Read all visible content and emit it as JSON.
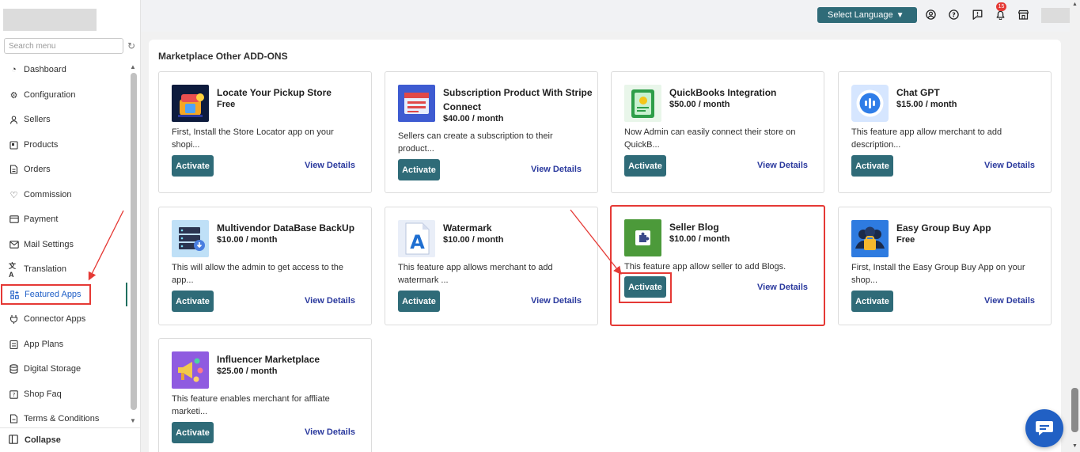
{
  "sidebar": {
    "search_placeholder": "Search menu",
    "refresh_icon": "refresh-icon",
    "items": [
      {
        "label": "Dashboard",
        "icon": "dashboard-icon"
      },
      {
        "label": "Configuration",
        "icon": "settings-icon"
      },
      {
        "label": "Sellers",
        "icon": "user-icon"
      },
      {
        "label": "Products",
        "icon": "product-icon"
      },
      {
        "label": "Orders",
        "icon": "orders-icon"
      },
      {
        "label": "Commission",
        "icon": "commission-icon"
      },
      {
        "label": "Payment",
        "icon": "payment-icon"
      },
      {
        "label": "Mail Settings",
        "icon": "mail-icon"
      },
      {
        "label": "Translation",
        "icon": "translation-icon"
      },
      {
        "label": "Featured Apps",
        "icon": "apps-icon"
      },
      {
        "label": "Connector Apps",
        "icon": "plug-icon"
      },
      {
        "label": "App Plans",
        "icon": "plans-icon"
      },
      {
        "label": "Digital Storage",
        "icon": "storage-icon"
      },
      {
        "label": "Shop Faq",
        "icon": "faq-icon"
      },
      {
        "label": "Terms & Conditions",
        "icon": "terms-icon"
      }
    ],
    "active_item": "Featured Apps",
    "collapse_label": "Collapse"
  },
  "topbar": {
    "language_button": "Select Language",
    "notification_count": "15",
    "icons": [
      "user-circle-icon",
      "help-icon",
      "feedback-icon",
      "bell-icon",
      "store-icon"
    ]
  },
  "main": {
    "section_title": "Marketplace Other ADD-ONS",
    "activate_label": "Activate",
    "details_label": "View Details",
    "cards": [
      {
        "title": "Locate Your Pickup Store",
        "price": "Free",
        "desc": "First, Install the Store Locator app on your shopi...",
        "icon": "store-locator-icon"
      },
      {
        "title": "Subscription Product With Stripe Connect",
        "price": "$40.00 / month",
        "desc": "Sellers can create a subscription to their product...",
        "icon": "subscription-icon"
      },
      {
        "title": "QuickBooks Integration",
        "price": "$50.00 / month",
        "desc": "Now Admin can easily connect their store on QuickB...",
        "icon": "quickbooks-icon"
      },
      {
        "title": "Chat GPT",
        "price": "$15.00 / month",
        "desc": "This feature app allow merchant to add description...",
        "icon": "chat-gpt-icon"
      },
      {
        "title": "Multivendor DataBase BackUp",
        "price": "$10.00 / month",
        "desc": "This will allow the admin to get access to the app...",
        "icon": "database-backup-icon"
      },
      {
        "title": "Watermark",
        "price": "$10.00 / month",
        "desc": "This feature app allows merchant to add watermark ...",
        "icon": "watermark-icon"
      },
      {
        "title": "Seller Blog",
        "price": "$10.00 / month",
        "desc": "This feature app allow seller to add Blogs.",
        "icon": "puzzle-icon"
      },
      {
        "title": "Easy Group Buy App",
        "price": "Free",
        "desc": "First, Install the Easy Group Buy App on your shop...",
        "icon": "group-buy-icon"
      },
      {
        "title": "Influencer Marketplace",
        "price": "$25.00 / month",
        "desc": "This feature enables merchant for affliate marketi...",
        "icon": "influencer-icon"
      }
    ]
  },
  "colors": {
    "accent": "#2f6b78",
    "link": "#2b3a9e",
    "highlight": "#e53935",
    "active_menu": "#1f5fc7",
    "chat": "#2160c4"
  },
  "chat_widget_icon": "chat-icon"
}
